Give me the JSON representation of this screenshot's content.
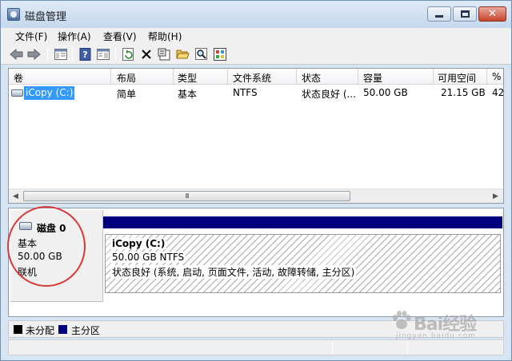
{
  "window": {
    "title": "磁盘管理"
  },
  "menu": [
    {
      "label": "文件(F)"
    },
    {
      "label": "操作(A)"
    },
    {
      "label": "查看(V)"
    },
    {
      "label": "帮助(H)"
    }
  ],
  "volume_table": {
    "columns": [
      "卷",
      "布局",
      "类型",
      "文件系统",
      "状态",
      "容量",
      "可用空间",
      "%"
    ],
    "rows": [
      {
        "volume": "iCopy (C:)",
        "layout": "简单",
        "type": "基本",
        "fs": "NTFS",
        "status": "状态良好 (...",
        "capacity": "50.00 GB",
        "free": "21.15 GB",
        "pct": "42"
      }
    ],
    "scroll_thumb": "III"
  },
  "disk": {
    "name": "磁盘 0",
    "kind": "基本",
    "size": "50.00 GB",
    "state": "联机"
  },
  "partition": {
    "name": "iCopy  (C:)",
    "size_fs": "50.00 GB NTFS",
    "status": "状态良好 (系统, 启动, 页面文件, 活动, 故障转储, 主分区)"
  },
  "legend": [
    {
      "label": "未分配",
      "color": "#000000"
    },
    {
      "label": "主分区",
      "color": "#00007f"
    }
  ],
  "colors": {
    "selection": "#3399ff",
    "primary_partition": "#00007f",
    "annotation": "#d83838"
  },
  "watermark": {
    "text": "Bai经验",
    "sub": "jingyan.baidu.com"
  }
}
